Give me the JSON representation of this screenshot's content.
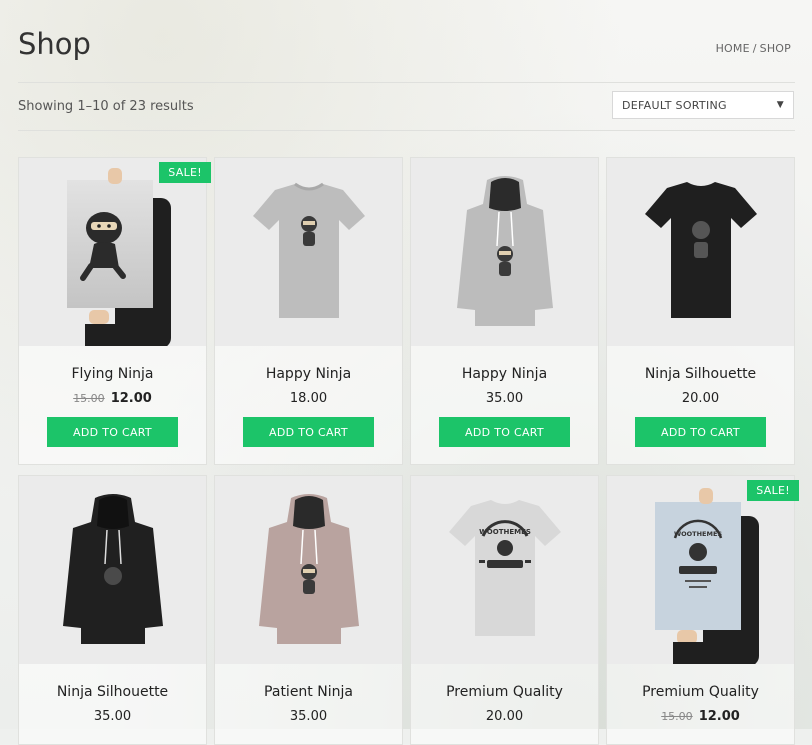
{
  "page": {
    "title": "Shop"
  },
  "breadcrumb": {
    "home": "HOME",
    "separator": "/",
    "current": "SHOP"
  },
  "results": {
    "text": "Showing 1–10 of 23 results"
  },
  "sorting": {
    "selected": "DEFAULT SORTING"
  },
  "sale_label": "SALE!",
  "accent_color": "#1cc469",
  "products": [
    {
      "name": "Flying Ninja",
      "old_price": "15.00",
      "price": "12.00",
      "button": "ADD TO CART",
      "image": "ninja-poster"
    },
    {
      "name": "Happy Ninja",
      "price": "18.00",
      "button": "ADD TO CART",
      "image": "grey-tshirt"
    },
    {
      "name": "Happy Ninja",
      "price": "35.00",
      "button": "ADD TO CART",
      "image": "grey-hoodie"
    },
    {
      "name": "Ninja Silhouette",
      "price": "20.00",
      "button": "ADD TO CART",
      "image": "black-tshirt"
    },
    {
      "name": "Ninja Silhouette",
      "price": "35.00",
      "image": "black-hoodie"
    },
    {
      "name": "Patient Ninja",
      "price": "35.00",
      "image": "pink-hoodie"
    },
    {
      "name": "Premium Quality",
      "price": "20.00",
      "image": "woothemes-tshirt"
    },
    {
      "name": "Premium Quality",
      "old_price": "15.00",
      "price": "12.00",
      "image": "woothemes-poster"
    }
  ],
  "logo_text": "WOOTHEMES"
}
